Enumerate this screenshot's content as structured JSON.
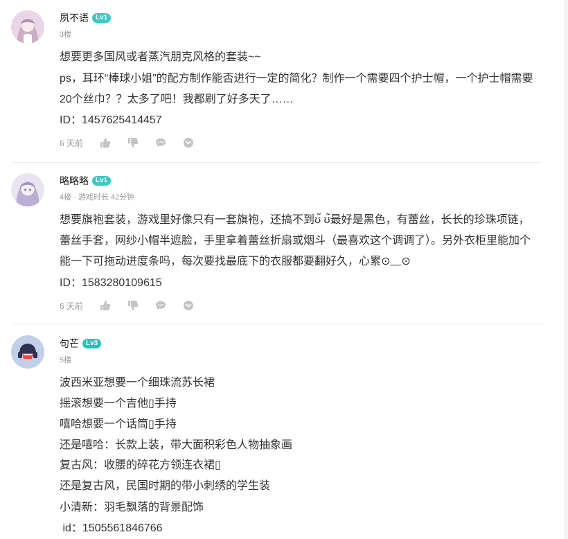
{
  "comments": [
    {
      "username": "夙不语",
      "level": "Lv1",
      "meta": "3楼",
      "lines": [
        "想要更多国风或者蒸汽朋克风格的套装~~",
        "ps，耳环“棒球小姐”的配方制作能否进行一定的简化？制作一个需要四个护士帽，一个护士帽需要",
        "20个丝巾？？太多了吧！我都刷了好多天了……",
        "ID：1457625414457"
      ],
      "time": "6 天前"
    },
    {
      "username": "略略略",
      "level": "Lv1",
      "meta": "4楼 · 游戏时长 42分钟",
      "lines": [
        "想要旗袍套装，游戏里好像只有一套旗袍，还搞不到ʊ̃ ʊ̃最好是黑色，有蕾丝，长长的珍珠项链，",
        "蕾丝手套，网纱小帽半遮脸，手里拿着蕾丝折扇或烟斗（最喜欢这个调调了）。另外衣柜里能加个",
        "能一下可拖动进度条吗，每次要找最底下的衣服都要翻好久，心累⊙﹏⊙",
        "ID：1583280109615"
      ],
      "time": "6 天前"
    },
    {
      "username": "句芒",
      "level": "Lv3",
      "meta": "5楼",
      "lines": [
        "波西米亚想要一个细珠流苏长裙",
        "摇滚想要一个吉他▯手持",
        "嘻哈想要一个话筒▯手持",
        "还是嘻哈：长款上装，带大面积彩色人物抽象画",
        "复古风：收腰的碎花方领连衣裙▯",
        "还是复古风，民国时期的带小刺绣的学生装",
        "小清新：羽毛飘落的背景配饰",
        " id：1505561846766"
      ]
    }
  ],
  "icons": {
    "like": "thumbs-up-icon",
    "dislike": "thumbs-down-icon",
    "reply": "speech-bubble-icon",
    "more": "chevron-down-circle-icon"
  },
  "colors": {
    "level_badge": "#3cc7c3",
    "meta_text": "#999999",
    "icon": "#c4c4c4"
  }
}
